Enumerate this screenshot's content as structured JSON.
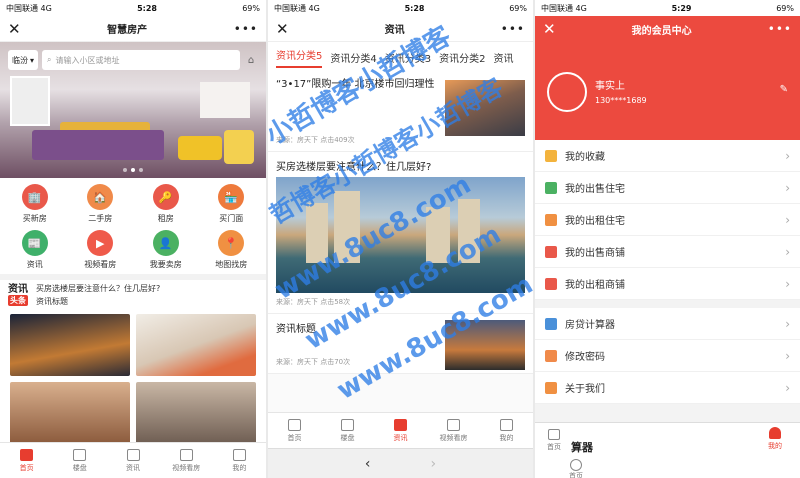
{
  "phone1": {
    "status": {
      "carrier": "中国联通",
      "network": "4G",
      "time": "5:28",
      "battery": "69%"
    },
    "title": "智慧房产",
    "close": "✕",
    "more": "•••",
    "city": "临汾",
    "search_placeholder": "请输入小区或地址",
    "grid": [
      {
        "label": "买新房",
        "color": "#e9584a",
        "icon": "🏢"
      },
      {
        "label": "二手房",
        "color": "#f08a4a",
        "icon": "🏠"
      },
      {
        "label": "租房",
        "color": "#e9584a",
        "icon": "🔑"
      },
      {
        "label": "买门面",
        "color": "#ee7a3c",
        "icon": "🏪"
      },
      {
        "label": "资讯",
        "color": "#3fb06a",
        "icon": "📰"
      },
      {
        "label": "视频看房",
        "color": "#ef5a4a",
        "icon": "▶"
      },
      {
        "label": "我要卖房",
        "color": "#4bb162",
        "icon": "👤"
      },
      {
        "label": "地图找房",
        "color": "#f09042",
        "icon": "📍"
      }
    ],
    "news": {
      "logo_top": "资讯",
      "logo_badge": "头条",
      "line1": "买房选楼层要注意什么？住几层好?",
      "line2": "资讯标题"
    },
    "tabs": [
      {
        "label": "首页",
        "active": true
      },
      {
        "label": "楼盘",
        "active": false
      },
      {
        "label": "资讯",
        "active": false
      },
      {
        "label": "视频看房",
        "active": false
      },
      {
        "label": "我的",
        "active": false
      }
    ]
  },
  "phone2": {
    "status": {
      "carrier": "中国联通",
      "network": "4G",
      "time": "5:28",
      "battery": "69%"
    },
    "title": "资讯",
    "close": "✕",
    "more": "•••",
    "category_tabs": [
      "资讯分类5",
      "资讯分类4",
      "资讯分类3",
      "资讯分类2",
      "资讯"
    ],
    "articles": [
      {
        "title": "“3•17”限购一年 北京楼市回归理性",
        "meta": "来源：房天下   点击409次"
      },
      {
        "title": "买房选楼层要注意什么？住几层好?",
        "meta": "来源：房天下   点击58次"
      },
      {
        "title": "资讯标题",
        "meta": "来源：房天下   点击70次"
      }
    ],
    "tabs": [
      {
        "label": "首页",
        "active": false
      },
      {
        "label": "楼盘",
        "active": false
      },
      {
        "label": "资讯",
        "active": true
      },
      {
        "label": "视频看房",
        "active": false
      },
      {
        "label": "我的",
        "active": false
      }
    ],
    "browser": {
      "back": "‹",
      "forward": "›"
    }
  },
  "phone3": {
    "status": {
      "carrier": "中国联通",
      "network": "4G",
      "time": "5:29",
      "battery": "69%"
    },
    "title": "我的会员中心",
    "close": "✕",
    "more": "•••",
    "user": {
      "name": "事实上",
      "phone": "130****1689"
    },
    "edit_icon": "✎",
    "menu1": [
      {
        "label": "我的收藏",
        "color": "#f3b33d"
      },
      {
        "label": "我的出售住宅",
        "color": "#4bb162"
      },
      {
        "label": "我的出租住宅",
        "color": "#f09042"
      },
      {
        "label": "我的出售商铺",
        "color": "#e9584a"
      },
      {
        "label": "我的出租商铺",
        "color": "#e9584a"
      }
    ],
    "menu2": [
      {
        "label": "房贷计算器",
        "color": "#4a90d9"
      },
      {
        "label": "修改密码",
        "color": "#f08a4a"
      },
      {
        "label": "关于我们",
        "color": "#f09042"
      }
    ],
    "bottom": {
      "left": "首页",
      "middle": "算器",
      "right": "我的",
      "below": "首页"
    }
  },
  "watermark": [
    "小哲博客小哲博客",
    "哲博客小哲博客小哲博客",
    "www.8uc8.com",
    "www.8uc8.com",
    "www.8uc8.com"
  ]
}
